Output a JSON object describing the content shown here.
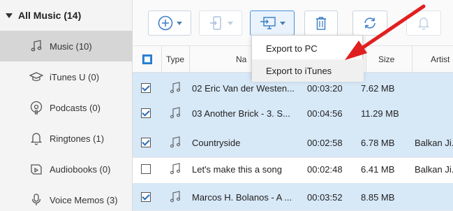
{
  "sidebar": {
    "header": "All Music (14)",
    "items": [
      {
        "label": "Music (10)",
        "icon": "music-note-icon",
        "active": true
      },
      {
        "label": "iTunes U (0)",
        "icon": "graduation-cap-icon",
        "active": false
      },
      {
        "label": "Podcasts (0)",
        "icon": "podcast-icon",
        "active": false
      },
      {
        "label": "Ringtones (1)",
        "icon": "bell-icon",
        "active": false
      },
      {
        "label": "Audiobooks (0)",
        "icon": "book-icon",
        "active": false
      },
      {
        "label": "Voice Memos (3)",
        "icon": "microphone-icon",
        "active": false
      }
    ]
  },
  "toolbar": {
    "buttons": [
      {
        "name": "add-button",
        "icon": "plus-circle-icon"
      },
      {
        "name": "device-transfer-button",
        "icon": "phone-transfer-icon"
      },
      {
        "name": "export-button",
        "icon": "export-to-computer-icon"
      },
      {
        "name": "delete-button",
        "icon": "trash-icon"
      },
      {
        "name": "refresh-button",
        "icon": "refresh-icon"
      },
      {
        "name": "ringtone-button",
        "icon": "bell-icon"
      }
    ]
  },
  "export_menu": {
    "items": [
      "Export to PC",
      "Export to iTunes"
    ]
  },
  "table": {
    "columns": {
      "type": "Type",
      "name": "Na",
      "size": "Size",
      "artist": "Artist"
    },
    "rows": [
      {
        "checked": true,
        "name": "02 Eric Van der Westen...",
        "time": "00:03:20",
        "size": "7.62 MB",
        "artist": ""
      },
      {
        "checked": true,
        "name": "03 Another Brick - 3. S...",
        "time": "00:04:56",
        "size": "11.29 MB",
        "artist": ""
      },
      {
        "checked": true,
        "name": "Countryside",
        "time": "00:02:58",
        "size": "6.78 MB",
        "artist": "Balkan Ji..."
      },
      {
        "checked": false,
        "name": "Let's make this a song",
        "time": "00:02:48",
        "size": "6.41 MB",
        "artist": "Balkan Ji..."
      },
      {
        "checked": true,
        "name": "Marcos H. Bolanos - A ...",
        "time": "00:03:52",
        "size": "8.85 MB",
        "artist": ""
      }
    ]
  },
  "colors": {
    "accent": "#2a8ae0",
    "selected_row": "#d7e8f7",
    "annotation_arrow": "#e02020"
  }
}
